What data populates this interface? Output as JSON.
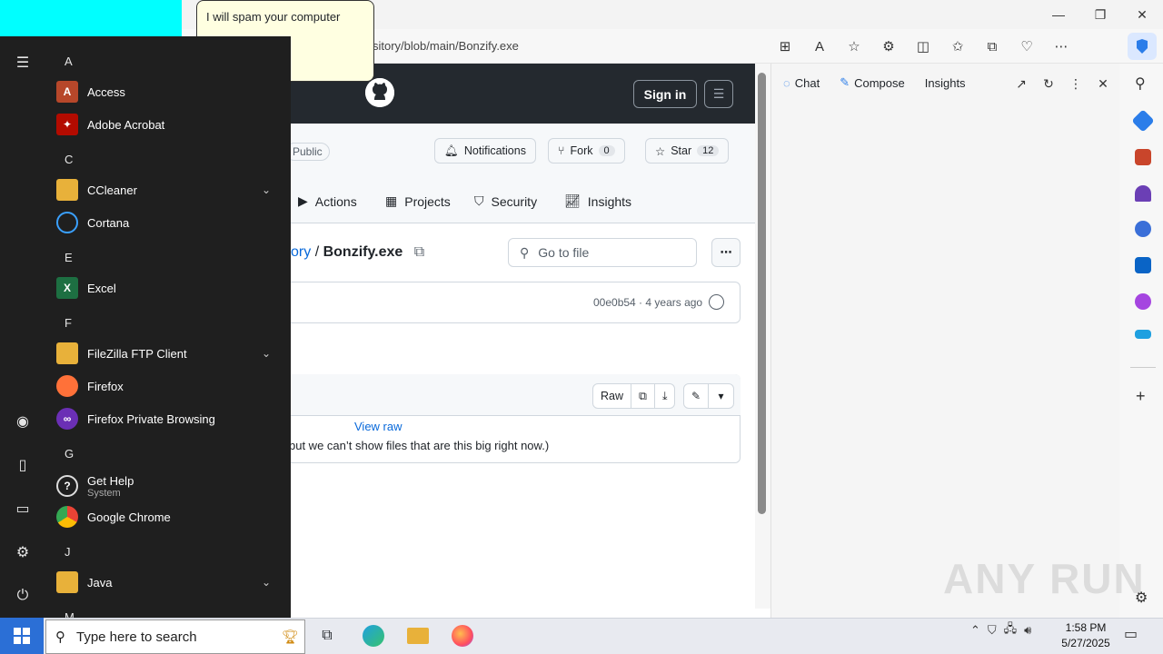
{
  "bubble": {
    "text": "I will spam your computer"
  },
  "browser": {
    "url": "sitory/blob/main/Bonzify.exe",
    "window_controls": {
      "minimize": "—",
      "restore": "❐",
      "close": "✕"
    }
  },
  "github": {
    "sign_in": "Sign in",
    "visibility": "Public",
    "notifications": "Notifications",
    "fork": {
      "label": "Fork",
      "count": "0"
    },
    "star": {
      "label": "Star",
      "count": "12"
    },
    "tabs": [
      "Actions",
      "Projects",
      "Security",
      "Insights"
    ],
    "breadcrumb": {
      "parent": "ory",
      "sep": "/",
      "file": "Bonzify.exe"
    },
    "goto_placeholder": "Go to file",
    "commit": "00e0b54 · 4 years ago",
    "raw": "Raw",
    "view_raw": "View raw",
    "big_note": "but we can’t show files that are this big right now.)"
  },
  "side_panel": {
    "tabs": [
      "Chat",
      "Compose",
      "Insights"
    ]
  },
  "watermark": "ANY RUN",
  "start_menu": {
    "letters": [
      "A",
      "C",
      "E",
      "F",
      "G",
      "J",
      "M"
    ],
    "items": [
      {
        "label": "Access",
        "color": "#b7472a",
        "glyph": "A"
      },
      {
        "label": "Adobe Acrobat",
        "color": "#b30b00",
        "glyph": "✦"
      },
      {
        "label": "CCleaner",
        "color": "#e8b13a",
        "glyph": ""
      },
      {
        "label": "Cortana",
        "color": "#1f1f1f",
        "glyph": ""
      },
      {
        "label": "Excel",
        "color": "#1d6f42",
        "glyph": "X"
      },
      {
        "label": "FileZilla FTP Client",
        "color": "#e8b13a",
        "glyph": ""
      },
      {
        "label": "Firefox",
        "color": "#ff7139",
        "glyph": ""
      },
      {
        "label": "Firefox Private Browsing",
        "color": "#6b2fb5",
        "glyph": "∞"
      },
      {
        "label": "Get Help",
        "sub": "System",
        "color": "#1f1f1f",
        "glyph": "?"
      },
      {
        "label": "Google Chrome",
        "color": "#34a853",
        "glyph": ""
      },
      {
        "label": "Java",
        "color": "#e8b13a",
        "glyph": ""
      }
    ]
  },
  "taskbar": {
    "search_placeholder": "Type here to search",
    "time": "1:58 PM",
    "date": "5/27/2025"
  }
}
